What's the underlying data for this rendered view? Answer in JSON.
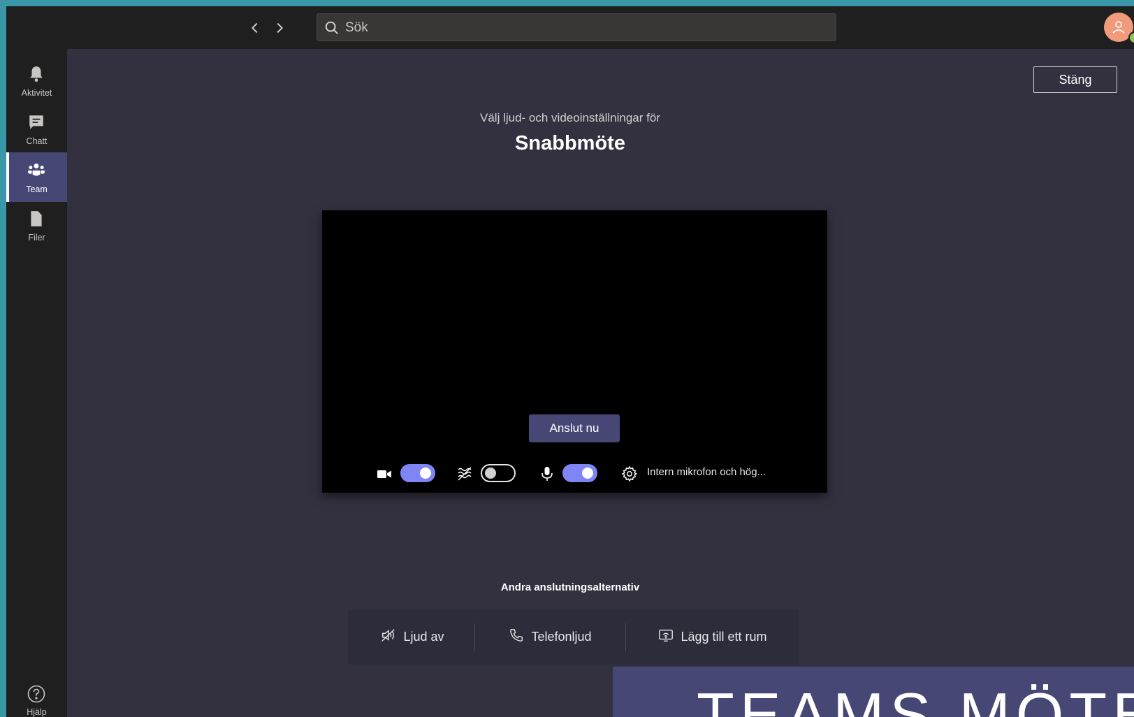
{
  "search": {
    "placeholder": "Sök"
  },
  "sidebar": {
    "items": [
      {
        "label": "Aktivitet",
        "icon": "bell-icon"
      },
      {
        "label": "Chatt",
        "icon": "chat-icon"
      },
      {
        "label": "Team",
        "icon": "team-icon",
        "active": true
      },
      {
        "label": "Filer",
        "icon": "file-icon"
      }
    ],
    "help": {
      "label": "Hjälp",
      "icon": "help-icon"
    }
  },
  "header": {
    "close_label": "Stäng"
  },
  "meeting": {
    "subtitle": "Välj ljud- och videoinställningar för",
    "title": "Snabbmöte"
  },
  "preview": {
    "join_label": "Anslut nu",
    "camera_on": true,
    "background_blur_on": false,
    "microphone_on": true,
    "device_label": "Intern mikrofon och hög..."
  },
  "other_options": {
    "title": "Andra anslutningsalternativ",
    "items": [
      {
        "label": "Ljud av",
        "icon": "speaker-off-icon"
      },
      {
        "label": "Telefonljud",
        "icon": "phone-icon"
      },
      {
        "label": "Lägg till ett rum",
        "icon": "room-cast-icon"
      }
    ]
  },
  "banner": {
    "text": "TEAMS MÖTE"
  },
  "colors": {
    "accent": "#464775",
    "toggle_on": "#7f85f5",
    "background": "#33313f",
    "presence": "#92c353",
    "avatar": "#f29b7c"
  }
}
